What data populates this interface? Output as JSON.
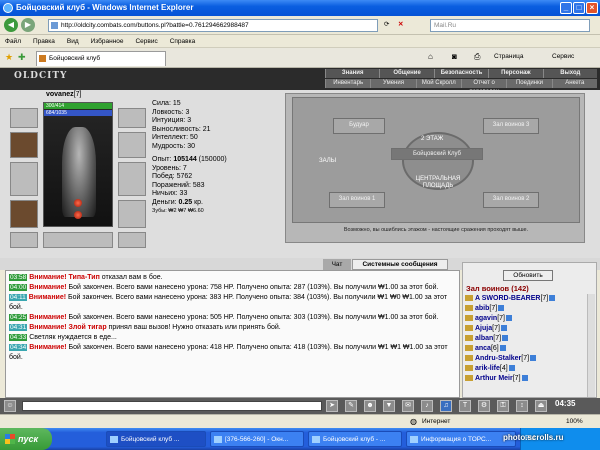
{
  "window": {
    "title": "Бойцовский клуб - Windows Internet Explorer"
  },
  "browser": {
    "address": "http://oldcity.combats.com/buttons.pl?battle=0.761294662988487",
    "search_placeholder": "Mail.Ru",
    "menu": [
      "Файл",
      "Правка",
      "Вид",
      "Избранное",
      "Сервис",
      "Справка"
    ],
    "tab_title": "Бойцовский клуб",
    "toolbar_page": "Страница",
    "toolbar_service": "Сервис"
  },
  "game": {
    "logo": "OLDCITY",
    "nav": [
      "Знания",
      "Общение",
      "Безопасность",
      "Персонаж",
      "Выход"
    ],
    "subnav": [
      "Инвентарь",
      "Умения",
      "Мой Скролл",
      "Отчет о переводах",
      "Поединки",
      "Анкета"
    ],
    "character": {
      "name": "vovanez",
      "level": "[7]",
      "hp": "300/414",
      "mp": "684/1035",
      "stats": [
        "Сила: 15",
        "Ловкость: 3",
        "Интуиция: 3",
        "Выносливость: 21",
        "Интеллект: 50",
        "Мудрость: 30"
      ],
      "exp_label": "Опыт: ",
      "exp_value": "105144",
      "exp_next": " (150000)",
      "info": [
        "Уровень: 7",
        "Побед: 5762",
        "Поражений: 583",
        "Ничьих: 33"
      ],
      "money_label": "Деньги: ",
      "money_value": "0.25",
      "money_unit": " кр.",
      "gems": "Зубы: ₩2 ₩7 ₩6.60"
    },
    "map": {
      "rooms": [
        "Будуар",
        "Зал воинов 3",
        "2 ЭТАЖ",
        "Бойцовский Клуб",
        "ЗАЛЫ",
        "ЦЕНТРАЛЬНАЯ ПЛОЩАДЬ",
        "Зал воинов 1",
        "Зал воинов 2"
      ],
      "note": "Возможно, вы ошиблись этажом - настоящие сражения проходят выше."
    },
    "tabs": {
      "chat": "Чат",
      "system": "Системные сообщения"
    },
    "chat": [
      {
        "time": "03:58",
        "warn": "Внимание!",
        "nick": "Типа-Тип",
        "text": " отказал вам в бое."
      },
      {
        "time": "04:00",
        "warn": "Внимание!",
        "nick": "",
        "text": " Бой закончен. Всего вами нанесено урона: 758 HP. Получено опыта: 287 (103%). Вы получили ₩1.00 за этот бой."
      },
      {
        "time": "04:11",
        "warn": "Внимание!",
        "nick": "",
        "text": " Бой закончен. Всего вами нанесено урона: 383 HP. Получено опыта: 384 (103%). Вы получили ₩1 ₩0 ₩1.00 за этот бой."
      },
      {
        "time": "04:25",
        "warn": "Внимание!",
        "nick": "",
        "text": " Бой закончен. Всего вами нанесено урона: 505 HP. Получено опыта: 303 (103%). Вы получили ₩1.00 за этот бой."
      },
      {
        "time": "04:31",
        "warn": "Внимание!",
        "nick": "Злой тигар",
        "text": " принял ваш вызов! Нужно отказать или принять бой."
      },
      {
        "time": "04:33",
        "warn": "",
        "nick": "",
        "text": "Светляк нуждается в еде..."
      },
      {
        "time": "04:34",
        "warn": "Внимание!",
        "nick": "",
        "text": " Бой закончен. Всего вами нанесено урона: 418 HP. Получено опыта: 418 (103%). Вы получили ₩1 ₩1 ₩1.00 за этот бой."
      }
    ],
    "room": {
      "refresh": "Обновить",
      "title": "Зал воинов (142)",
      "users": [
        {
          "name": "A SWORD-BEARER",
          "level": "[7]"
        },
        {
          "name": "abib",
          "level": "[7]"
        },
        {
          "name": "agavin",
          "level": "[7]"
        },
        {
          "name": "Ajuja",
          "level": "[7]"
        },
        {
          "name": "alban",
          "level": "[7]"
        },
        {
          "name": "anca",
          "level": "[6]"
        },
        {
          "name": "Andru-Stalker",
          "level": "[7]"
        },
        {
          "name": "arik-life",
          "level": "[4]"
        },
        {
          "name": "Arthur Meir",
          "level": "[7]"
        }
      ]
    },
    "clock": "04:35"
  },
  "status": {
    "zone": "Интернет",
    "zoom": "100%"
  },
  "taskbar": {
    "start": "пуск",
    "tasks": [
      "Бойцовский клуб ...",
      "[376-566-260] - Окн...",
      "Бойцовский клуб - ...",
      "Информация о ТОРС..."
    ],
    "lang": "RU"
  },
  "watermark": "photo.scrolls.ru"
}
